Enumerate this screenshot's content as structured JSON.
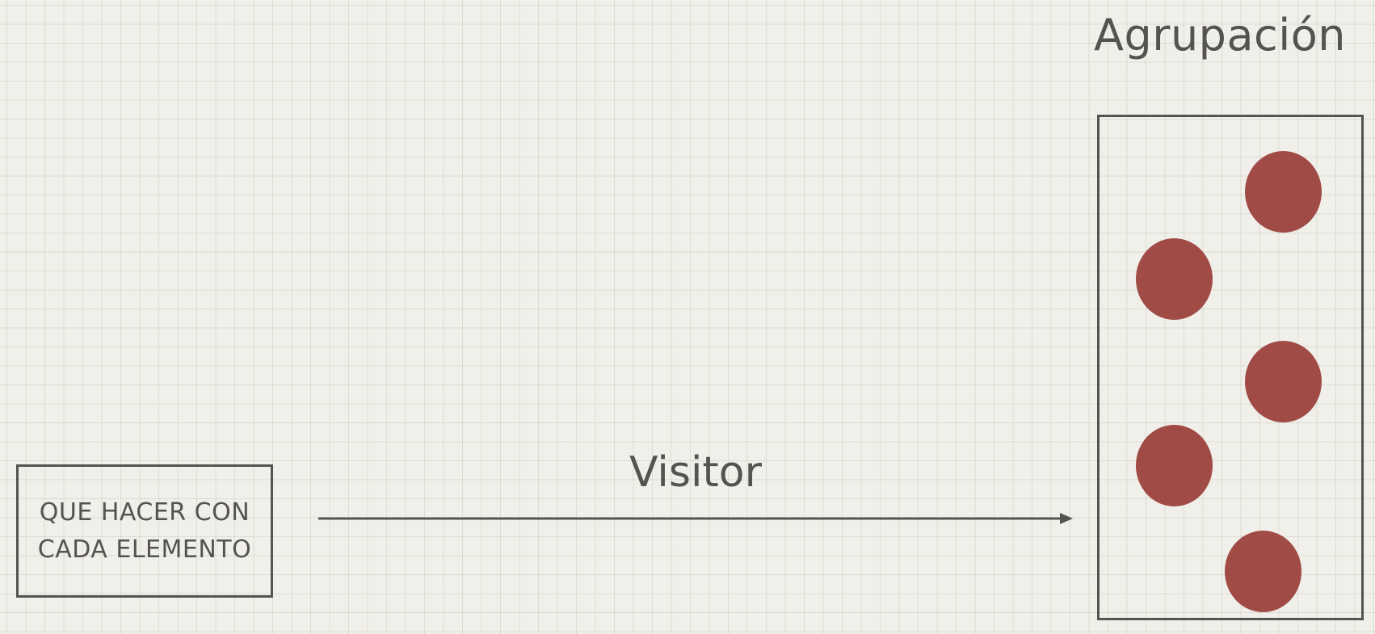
{
  "title": "Agrupación",
  "action_box": {
    "label": "QUE HACER CON\nCADA ELEMENTO"
  },
  "arrow": {
    "label": "Visitor"
  },
  "group": {
    "elements": [
      "element",
      "element",
      "element",
      "element",
      "element"
    ]
  },
  "colors": {
    "ink": "#55534f",
    "element": "#a04b46",
    "paper": "#f1efe9"
  }
}
